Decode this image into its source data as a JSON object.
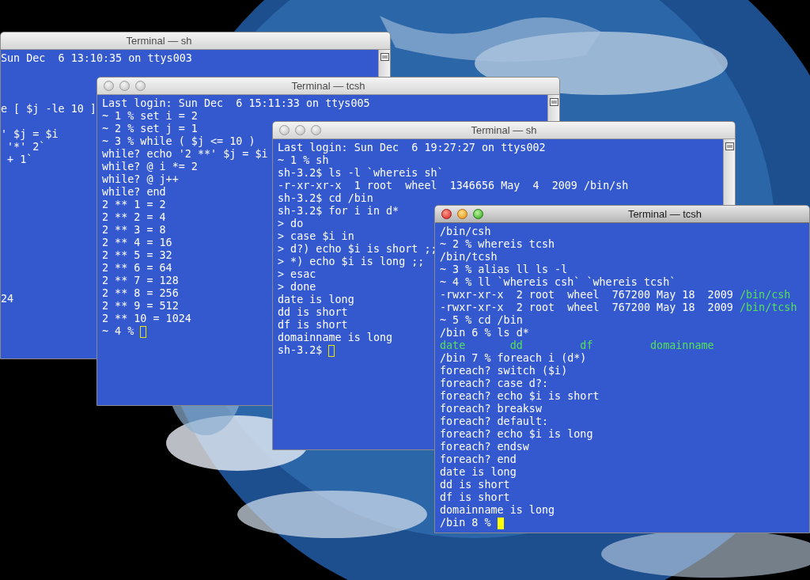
{
  "windows": [
    {
      "title": "Terminal — sh",
      "focused": false,
      "window_buttons": false,
      "scrollbar": true,
      "lines": [
        "Sun Dec  6 13:10:35 on ttys003",
        "e [ $j -le 10 ]",
        "' $j = $i",
        " '*' 2`",
        " + 1`",
        "24"
      ]
    },
    {
      "title": "Terminal — tcsh",
      "focused": false,
      "window_buttons": true,
      "scrollbar": true,
      "lines": [
        "Last login: Sun Dec  6 15:11:33 on ttys005",
        "~ 1 % set i = 2",
        "~ 2 % set j = 1",
        "~ 3 % while ( $j <= 10 )",
        "while? echo '2 **' $j = $i",
        "while? @ i *= 2",
        "while? @ j++",
        "while? end",
        "2 ** 1 = 2",
        "2 ** 2 = 4",
        "2 ** 3 = 8",
        "2 ** 4 = 16",
        "2 ** 5 = 32",
        "2 ** 6 = 64",
        "2 ** 7 = 128",
        "2 ** 8 = 256",
        "2 ** 9 = 512",
        "2 ** 10 = 1024",
        {
          "text": "~ 4 %",
          "cursor": true
        }
      ]
    },
    {
      "title": "Terminal — sh",
      "focused": false,
      "window_buttons": true,
      "scrollbar": true,
      "lines": [
        "Last login: Sun Dec  6 19:27:27 on ttys002",
        "~ 1 % sh",
        "sh-3.2$ ls -l `whereis sh`",
        "-r-xr-xr-x  1 root  wheel  1346656 May  4  2009 /bin/sh",
        "sh-3.2$ cd /bin",
        "sh-3.2$ for i in d*",
        "> do",
        "> case $i in",
        "> d?) echo $i is short ;;",
        "> *) echo $i is long ;;",
        "> esac",
        "> done",
        "date is long",
        "dd is short",
        "df is short",
        "domainname is long",
        {
          "text": "sh-3.2$",
          "cursor": true
        }
      ]
    },
    {
      "title": "Terminal — tcsh",
      "focused": true,
      "window_buttons": true,
      "scrollbar": false,
      "lines": [
        "/bin/csh",
        "~ 2 % whereis tcsh",
        "/bin/tcsh",
        "~ 3 % alias ll ls -l",
        "~ 4 % ll `whereis csh` `whereis tcsh`",
        {
          "parts": [
            {
              "text": "-rwxr-xr-x  2 root  wheel  767200 May 18  2009 ",
              "kind": "plain"
            },
            {
              "text": "/bin/csh",
              "kind": "executable"
            }
          ]
        },
        {
          "parts": [
            {
              "text": "-rwxr-xr-x  2 root  wheel  767200 May 18  2009 ",
              "kind": "plain"
            },
            {
              "text": "/bin/tcsh",
              "kind": "executable"
            }
          ]
        },
        "~ 5 % cd /bin",
        "/bin 6 % ls d*",
        {
          "parts": [
            {
              "text": "date       dd         df         domainname",
              "kind": "executable"
            }
          ]
        },
        "/bin 7 % foreach i (d*)",
        "foreach? switch ($i)",
        "foreach? case d?:",
        "foreach? echo $i is short",
        "foreach? breaksw",
        "foreach? default:",
        "foreach? echo $i is long",
        "foreach? endsw",
        "foreach? end",
        "date is long",
        "dd is short",
        "df is short",
        "domainname is long",
        {
          "text": "/bin 8 %",
          "cursor": true
        }
      ]
    }
  ]
}
